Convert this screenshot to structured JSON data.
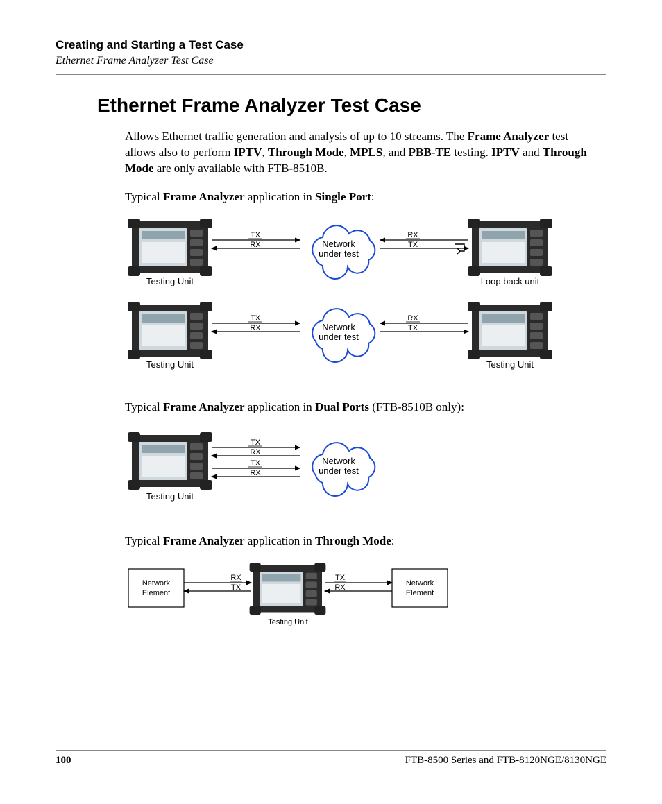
{
  "header": {
    "title": "Creating and Starting a Test Case",
    "subtitle": "Ethernet Frame Analyzer Test Case"
  },
  "h1": "Ethernet Frame Analyzer Test Case",
  "intro": {
    "p1a": "Allows Ethernet traffic generation and analysis of up to 10 streams. The ",
    "fa": "Frame Analyzer",
    "p1b": " test allows also to perform ",
    "iptv": "IPTV",
    "sep1": ", ",
    "through": "Through Mode",
    "sep2": ", ",
    "mpls": "MPLS",
    "sep3": ", and ",
    "pbbte": "PBB-TE",
    "p1c": " testing. ",
    "iptv2": "IPTV",
    "and": " and ",
    "through2": "Through Mode",
    "p1d": " are only available with FTB-8510B."
  },
  "cap1": {
    "a": "Typical ",
    "b": "Frame Analyzer",
    "c": " application in ",
    "d": "Single Port",
    "e": ":"
  },
  "cap2": {
    "a": "Typical ",
    "b": "Frame Analyzer",
    "c": " application in ",
    "d": "Dual Ports",
    "e": " (FTB-8510B only):"
  },
  "cap3": {
    "a": "Typical ",
    "b": "Frame Analyzer",
    "c": " application in ",
    "d": "Through Mode",
    "e": ":"
  },
  "diag": {
    "testing_unit": "Testing Unit",
    "loopback": "Loop back unit",
    "nut_l1": "Network",
    "nut_l2": "under test",
    "net_elem_l1": "Network",
    "net_elem_l2": "Element",
    "tx": "TX",
    "rx": "RX"
  },
  "footer": {
    "page": "100",
    "doc": "FTB-8500 Series and FTB-8120NGE/8130NGE"
  }
}
